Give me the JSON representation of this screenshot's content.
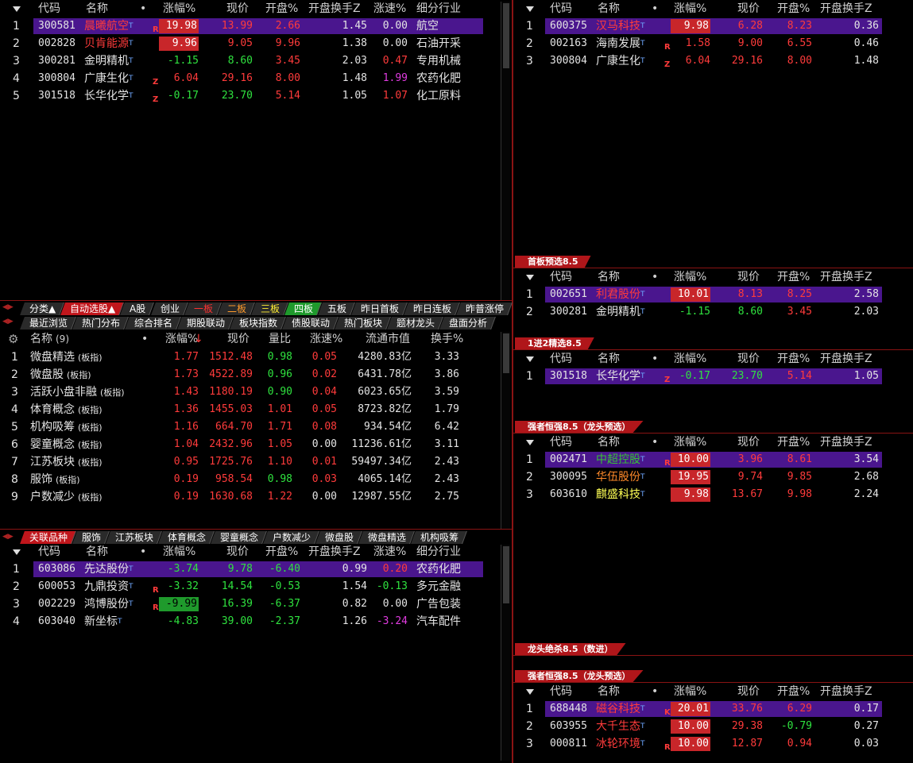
{
  "columns_main": {
    "code": "代码",
    "name": "名称",
    "dot": "•",
    "pct": "涨幅%",
    "price": "现价",
    "open": "开盘%",
    "turn": "开盘换手Z",
    "speed": "涨速%",
    "ind": "细分行业"
  },
  "top_left_rows": [
    {
      "n": "1",
      "code": "300581",
      "name": "晨曦航空",
      "tag": "R",
      "pct": "19.98",
      "price": "13.99",
      "open": "2.66",
      "turn": "1.45",
      "speed": "0.00",
      "ind": "航空"
    },
    {
      "n": "2",
      "code": "002828",
      "name": "贝肯能源",
      "tag": "",
      "pct": "9.96",
      "price": "9.05",
      "open": "9.96",
      "turn": "1.38",
      "speed": "0.00",
      "ind": "石油开采"
    },
    {
      "n": "3",
      "code": "300281",
      "name": "金明精机",
      "tag": "",
      "pct": "-1.15",
      "price": "8.60",
      "open": "3.45",
      "turn": "2.03",
      "speed": "0.47",
      "ind": "专用机械"
    },
    {
      "n": "4",
      "code": "300804",
      "name": "广康生化",
      "tag": "Z",
      "pct": "6.04",
      "price": "29.16",
      "open": "8.00",
      "turn": "1.48",
      "speed": "1.99",
      "ind": "农药化肥"
    },
    {
      "n": "5",
      "code": "301518",
      "name": "长华化学",
      "tag": "Z",
      "pct": "-0.17",
      "price": "23.70",
      "open": "5.14",
      "turn": "1.05",
      "speed": "1.07",
      "ind": "化工原料"
    }
  ],
  "tabs_row1": [
    "分类▲",
    "自动选股▲",
    "A股",
    "创业",
    "一板",
    "二板",
    "三板",
    "四板",
    "五板",
    "昨日首板",
    "昨日连板",
    "昨普涨停"
  ],
  "tabs_row2": [
    "最近浏览",
    "热门分布",
    "综合排名",
    "期股联动",
    "板块指数",
    "债股联动",
    "热门板块",
    "题材龙头",
    "盘面分析"
  ],
  "index_header": {
    "name": "名称",
    "count": "(9)",
    "dot": "•",
    "pct": "涨幅%",
    "sort": "↓",
    "price": "现价",
    "vr": "量比",
    "speed": "涨速%",
    "cap": "流通市值",
    "turn": "换手%"
  },
  "index_rows": [
    {
      "n": "1",
      "name": "微盘精选",
      "suffix": "(板指)",
      "pct": "1.77",
      "price": "1512.48",
      "vr": "0.98",
      "speed": "0.05",
      "cap": "4280.83亿",
      "turn": "3.33"
    },
    {
      "n": "2",
      "name": "微盘股",
      "suffix": "(板指)",
      "pct": "1.73",
      "price": "4522.89",
      "vr": "0.96",
      "speed": "0.02",
      "cap": "6431.78亿",
      "turn": "3.86"
    },
    {
      "n": "3",
      "name": "活跃小盘非融",
      "suffix": "(板指)",
      "pct": "1.43",
      "price": "1180.19",
      "vr": "0.90",
      "speed": "0.04",
      "cap": "6023.65亿",
      "turn": "3.59"
    },
    {
      "n": "4",
      "name": "体育概念",
      "suffix": "(板指)",
      "pct": "1.36",
      "price": "1455.03",
      "vr": "1.01",
      "speed": "0.05",
      "cap": "8723.82亿",
      "turn": "1.79"
    },
    {
      "n": "5",
      "name": "机构吸筹",
      "suffix": "(板指)",
      "pct": "1.16",
      "price": "664.70",
      "vr": "1.71",
      "speed": "0.08",
      "cap": "934.54亿",
      "turn": "6.42"
    },
    {
      "n": "6",
      "name": "婴童概念",
      "suffix": "(板指)",
      "pct": "1.04",
      "price": "2432.96",
      "vr": "1.05",
      "speed": "0.00",
      "cap": "11236.61亿",
      "turn": "3.11"
    },
    {
      "n": "7",
      "name": "江苏板块",
      "suffix": "(板指)",
      "pct": "0.95",
      "price": "1725.76",
      "vr": "1.10",
      "speed": "0.01",
      "cap": "59497.34亿",
      "turn": "2.43"
    },
    {
      "n": "8",
      "name": "服饰",
      "suffix": "(板指)",
      "pct": "0.19",
      "price": "958.54",
      "vr": "0.98",
      "speed": "0.03",
      "cap": "4065.14亿",
      "turn": "2.43"
    },
    {
      "n": "9",
      "name": "户数减少",
      "suffix": "(板指)",
      "pct": "0.19",
      "price": "1630.68",
      "vr": "1.22",
      "speed": "0.00",
      "cap": "12987.55亿",
      "turn": "2.75"
    }
  ],
  "tabs_row3": [
    "关联品种",
    "服饰",
    "江苏板块",
    "体育概念",
    "婴童概念",
    "户数减少",
    "微盘股",
    "微盘精选",
    "机构吸筹"
  ],
  "bottom_left_rows": [
    {
      "n": "1",
      "code": "603086",
      "name": "先达股份",
      "tag": "",
      "pct": "-3.74",
      "price": "9.78",
      "open": "-6.40",
      "turn": "0.99",
      "speed": "0.20",
      "ind": "农药化肥"
    },
    {
      "n": "2",
      "code": "600053",
      "name": "九鼎投资",
      "tag": "R",
      "pct": "-3.32",
      "price": "14.54",
      "open": "-0.53",
      "turn": "1.54",
      "speed": "-0.13",
      "ind": "多元金融"
    },
    {
      "n": "3",
      "code": "002229",
      "name": "鸿博股份",
      "tag": "R",
      "pct": "-9.99",
      "price": "16.39",
      "open": "-6.37",
      "turn": "0.82",
      "speed": "0.00",
      "ind": "广告包装"
    },
    {
      "n": "4",
      "code": "603040",
      "name": "新坐标",
      "tag": "",
      "pct": "-4.83",
      "price": "39.00",
      "open": "-2.37",
      "turn": "1.26",
      "speed": "-3.24",
      "ind": "汽车配件"
    }
  ],
  "right_panel1_rows": [
    {
      "n": "1",
      "code": "600375",
      "name": "汉马科技",
      "tag": "",
      "pct": "9.98",
      "price": "6.28",
      "open": "8.23",
      "turn": "0.36"
    },
    {
      "n": "2",
      "code": "002163",
      "name": "海南发展",
      "tag": "R",
      "pct": "1.58",
      "price": "9.00",
      "open": "6.55",
      "turn": "0.46"
    },
    {
      "n": "3",
      "code": "300804",
      "name": "广康生化",
      "tag": "Z",
      "pct": "6.04",
      "price": "29.16",
      "open": "8.00",
      "turn": "1.48"
    }
  ],
  "banner1": "首板预选8.5",
  "right_panel2_rows": [
    {
      "n": "1",
      "code": "002651",
      "name": "利君股份",
      "tag": "",
      "pct": "10.01",
      "price": "8.13",
      "open": "8.25",
      "turn": "2.58"
    },
    {
      "n": "2",
      "code": "300281",
      "name": "金明精机",
      "tag": "",
      "pct": "-1.15",
      "price": "8.60",
      "open": "3.45",
      "turn": "2.03"
    }
  ],
  "banner2": "1进2精选8.5",
  "right_panel3_rows": [
    {
      "n": "1",
      "code": "301518",
      "name": "长华化学",
      "tag": "Z",
      "pct": "-0.17",
      "price": "23.70",
      "open": "5.14",
      "turn": "1.05"
    }
  ],
  "banner3": "强者恒强8.5（龙头预选）",
  "right_panel4_rows": [
    {
      "n": "1",
      "code": "002471",
      "name": "中超控股",
      "tag": "R",
      "pct": "10.00",
      "price": "3.96",
      "open": "8.61",
      "turn": "3.54"
    },
    {
      "n": "2",
      "code": "300095",
      "name": "华伍股份",
      "tag": "",
      "pct": "19.95",
      "price": "9.74",
      "open": "9.85",
      "turn": "2.68"
    },
    {
      "n": "3",
      "code": "603610",
      "name": "麒盛科技",
      "tag": "",
      "pct": "9.98",
      "price": "13.67",
      "open": "9.98",
      "turn": "2.24"
    }
  ],
  "banner4": "龙头绝杀8.5（数进）",
  "banner5": "强者恒强8.5（龙头预选）",
  "right_panel5_rows": [
    {
      "n": "1",
      "code": "688448",
      "name": "磁谷科技",
      "tag": "K",
      "pct": "20.01",
      "price": "33.76",
      "open": "6.29",
      "turn": "0.17"
    },
    {
      "n": "2",
      "code": "603955",
      "name": "大千生态",
      "tag": "",
      "pct": "10.00",
      "price": "29.38",
      "open": "-0.79",
      "turn": "0.27"
    },
    {
      "n": "3",
      "code": "000811",
      "name": "冰轮环境",
      "tag": "R",
      "pct": "10.00",
      "price": "12.87",
      "open": "0.94",
      "turn": "0.03"
    }
  ],
  "t_mark": "T",
  "colors": {
    "up": "#ff3b3b",
    "down": "#2fe23f",
    "highlight": "#4a168e",
    "banner": "#b0161a",
    "divider": "#8a1313"
  }
}
